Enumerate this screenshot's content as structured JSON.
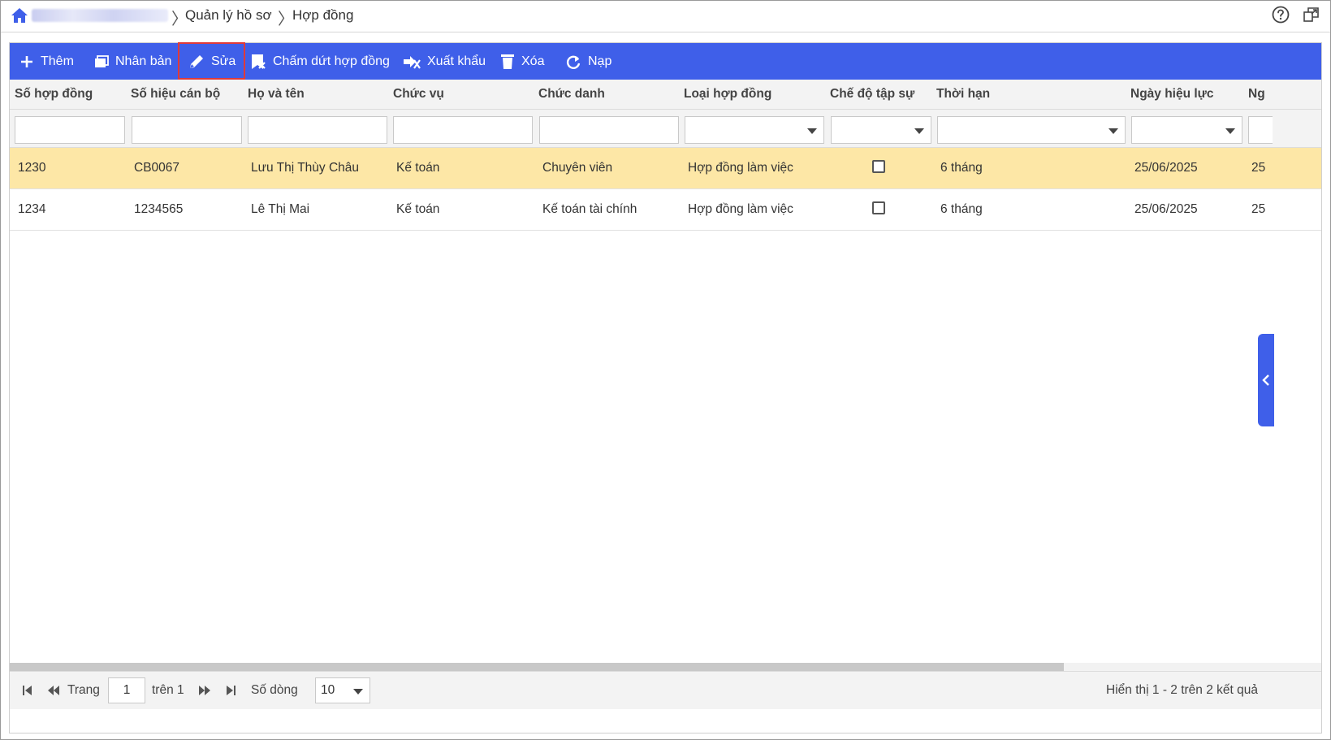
{
  "breadcrumb": {
    "items": [
      "Quản lý hồ sơ",
      "Hợp đồng"
    ]
  },
  "toolbar": {
    "buttons": [
      {
        "label": "Thêm",
        "icon": "plus-icon"
      },
      {
        "label": "Nhân bản",
        "icon": "copy-icon"
      },
      {
        "label": "Sửa",
        "icon": "pencil-icon"
      },
      {
        "label": "Chấm dứt hợp đồng",
        "icon": "contract-end-icon"
      },
      {
        "label": "Xuất khẩu",
        "icon": "export-icon"
      },
      {
        "label": "Xóa",
        "icon": "trash-icon"
      },
      {
        "label": "Nạp",
        "icon": "refresh-icon"
      }
    ],
    "accent": "#3f5fe9"
  },
  "table": {
    "columns": [
      "Số hợp đồng",
      "Số hiệu cán bộ",
      "Họ và tên",
      "Chức vụ",
      "Chức danh",
      "Loại hợp đồng",
      "Chế độ tập sự",
      "Thời hạn",
      "Ngày hiệu lực",
      "Ng"
    ],
    "rows": [
      {
        "so_hop_dong": "1230",
        "so_hieu": "CB0067",
        "ho_ten": "Lưu Thị Thùy Châu",
        "chuc_vu": "Kế toán",
        "chuc_danh": "Chuyên viên",
        "loai": "Hợp đồng làm việc",
        "tap_su": false,
        "thoi_han": "6 tháng",
        "ngay_hieu_luc": "25/06/2025",
        "ng": "25"
      },
      {
        "so_hop_dong": "1234",
        "so_hieu": "1234565",
        "ho_ten": "Lê Thị Mai",
        "chuc_vu": "Kế toán",
        "chuc_danh": "Kế toán tài chính",
        "loai": "Hợp đồng làm việc",
        "tap_su": false,
        "thoi_han": "6 tháng",
        "ngay_hieu_luc": "25/06/2025",
        "ng": "25"
      }
    ],
    "selected_row_color": "#fde7a6"
  },
  "pager": {
    "page_label": "Trang",
    "page_value": "1",
    "of_label": "trên 1",
    "rows_label": "Số dòng",
    "rows_value": "10",
    "summary": "Hiển thị 1 - 2 trên 2 kết quả"
  }
}
